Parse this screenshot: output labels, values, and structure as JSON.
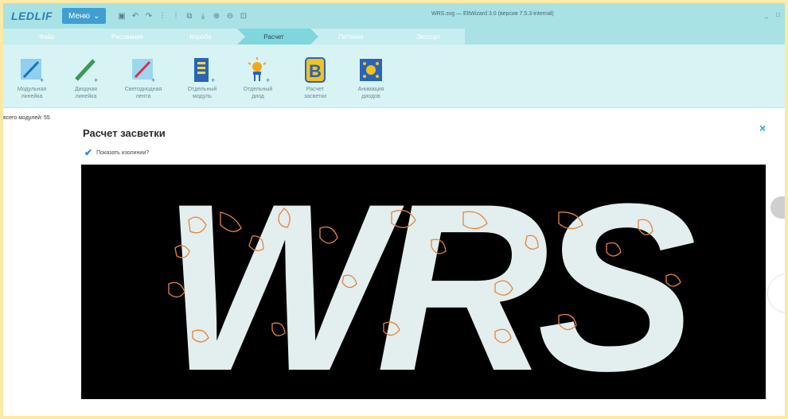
{
  "app": {
    "logo": "LEDLIF",
    "menu_label": "Меню",
    "window_title": "WRS.svg — EltWizard 3.0 (версия 7.5.3-internal)",
    "window_controls": [
      "_",
      "□"
    ]
  },
  "steps": [
    {
      "label": "Файл",
      "active": false
    },
    {
      "label": "Рисование",
      "active": false
    },
    {
      "label": "Короба",
      "active": false
    },
    {
      "label": "Расчет",
      "active": true
    },
    {
      "label": "Питание",
      "active": false
    },
    {
      "label": "Экспорт",
      "active": false
    }
  ],
  "ribbon": [
    {
      "label": "Модульная\nлинейка",
      "icon": "module-line-icon"
    },
    {
      "label": "Диодная\nлинейка",
      "icon": "diode-line-icon"
    },
    {
      "label": "Светодиодная\nлента",
      "icon": "led-strip-icon"
    },
    {
      "label": "Отдельный\nмодуль",
      "icon": "single-module-icon"
    },
    {
      "label": "Отдельный\nдиод",
      "icon": "single-diode-icon"
    },
    {
      "label": "Расчет\nзасветки",
      "icon": "lighting-calc-icon"
    },
    {
      "label": "Анимация\nдиодов",
      "icon": "diode-animation-icon"
    }
  ],
  "left_info": "всего модулей: 55",
  "dialog": {
    "title": "Расчет засветки",
    "show_isolines_label": "Показать изолинии?",
    "show_isolines_checked": true,
    "close_label": "×",
    "preview_text": "WRS"
  },
  "colors": {
    "accent": "#3e9fd0",
    "isoline": "#e4843e",
    "background": "#000000",
    "letters": "#e3eeee"
  }
}
